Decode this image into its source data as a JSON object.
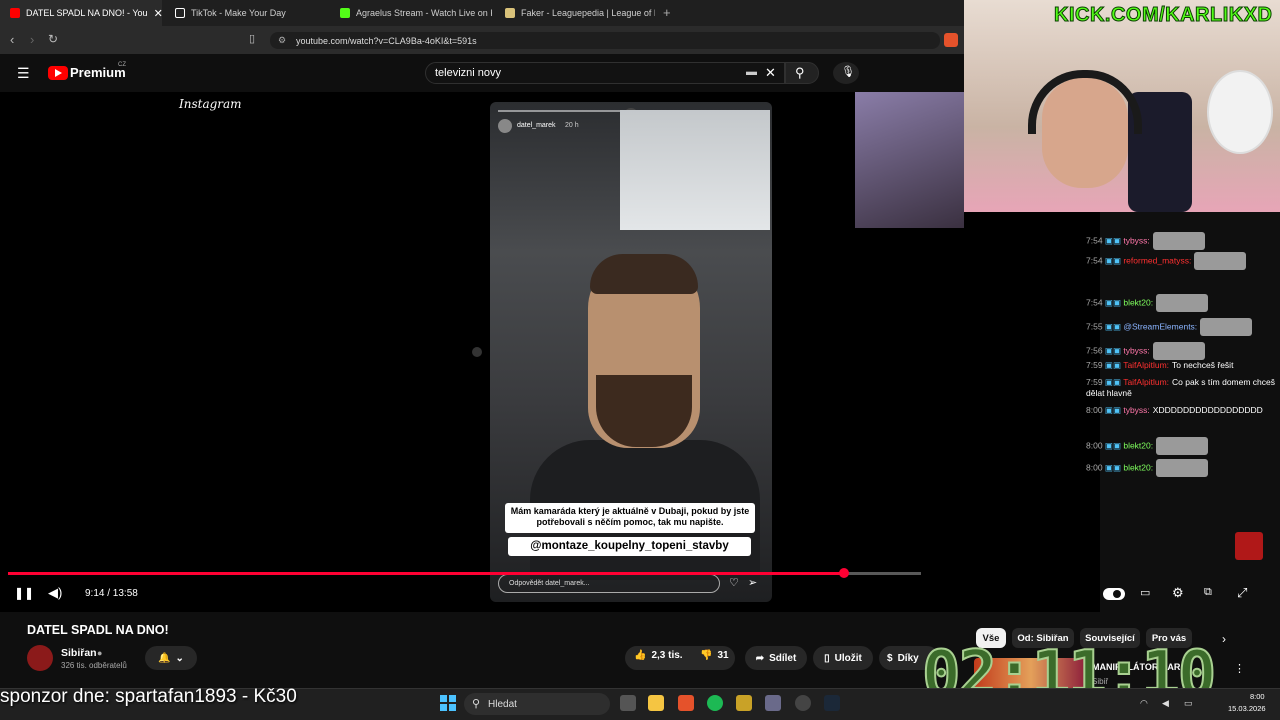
{
  "browser": {
    "tabs": [
      {
        "label": "DATEL SPADL NA DNO! - You",
        "active": true,
        "color": "#ff0000"
      },
      {
        "label": "TikTok - Make Your Day",
        "active": false,
        "color": "#ffffff"
      },
      {
        "label": "Agraelus Stream - Watch Live on Kick",
        "active": false,
        "color": "#53fc18"
      },
      {
        "label": "Faker - Leaguepedia | League of Lege",
        "active": false,
        "color": "#d9c27a"
      }
    ],
    "url": "youtube.com/watch?v=CLA9Ba-4oKI&t=591s"
  },
  "youtube": {
    "logo_text": "Premium",
    "logo_region": "CZ",
    "search_value": "televizni novy"
  },
  "player": {
    "instagram_label": "Instagram",
    "story_user": "datel_marek",
    "story_age": "20 h",
    "caption": "Mám kamaráda který je aktuálně v Dubaji, pokud by jste potřebovali s něčím pomoc, tak mu napište.",
    "mention": "@montaze_koupelny_topeni_stavby",
    "reply_placeholder": "Odpovědět datel_marek...",
    "time": "9:14 / 13:58",
    "progress_fraction": 0.9155
  },
  "video": {
    "title": "DATEL SPADL NA DNO!",
    "channel": "Sibiřan",
    "subscribers": "326 tis. odběratelů",
    "likes": "2,3 tis.",
    "dislikes": "31",
    "share": "Sdílet",
    "save": "Uložit",
    "thanks": "Díky"
  },
  "chips": [
    "Vše",
    "Od: Sibiřan",
    "Související",
    "Pro vás"
  ],
  "side_video": {
    "title": "MANIPULÁTOR CAR",
    "channel": "Sibiř"
  },
  "stream": {
    "kick_url": "KICK.COM/KARLIKXD",
    "timer": "02:11:10",
    "sponsor": "sponzor dne: spartafan1893 - Kč30"
  },
  "chat": [
    {
      "time": "7:54",
      "user": "tybyss:",
      "text": "",
      "color": "pink",
      "emote": true
    },
    {
      "time": "7:54",
      "user": "reformed_matyss:",
      "text": "",
      "color": "red",
      "emote": true
    },
    {
      "time": "7:54",
      "user": "blekt20:",
      "text": "",
      "color": "green",
      "emote": true
    },
    {
      "time": "7:55",
      "user": "@StreamElements:",
      "text": "",
      "color": "blue",
      "emote": true
    },
    {
      "time": "7:56",
      "user": "tybyss:",
      "text": "",
      "color": "pink",
      "emote": true
    },
    {
      "time": "7:59",
      "user": "TaifAlpitlum:",
      "text": "To nechceš řešit",
      "color": "red",
      "emote": false
    },
    {
      "time": "7:59",
      "user": "TaifAlpitlum:",
      "text": "Co pak s tím domem chceš dělat hlavně",
      "color": "red",
      "emote": false
    },
    {
      "time": "8:00",
      "user": "tybyss:",
      "text": "XDDDDDDDDDDDDDDDDD",
      "color": "pink",
      "emote": false
    },
    {
      "time": "8:00",
      "user": "blekt20:",
      "text": "",
      "color": "green",
      "emote": true
    },
    {
      "time": "8:00",
      "user": "blekt20:",
      "text": "",
      "color": "green",
      "emote": true
    }
  ],
  "taskbar": {
    "search_placeholder": "Hledat",
    "clock_time": "8:00",
    "clock_date": "15.03.2026"
  }
}
